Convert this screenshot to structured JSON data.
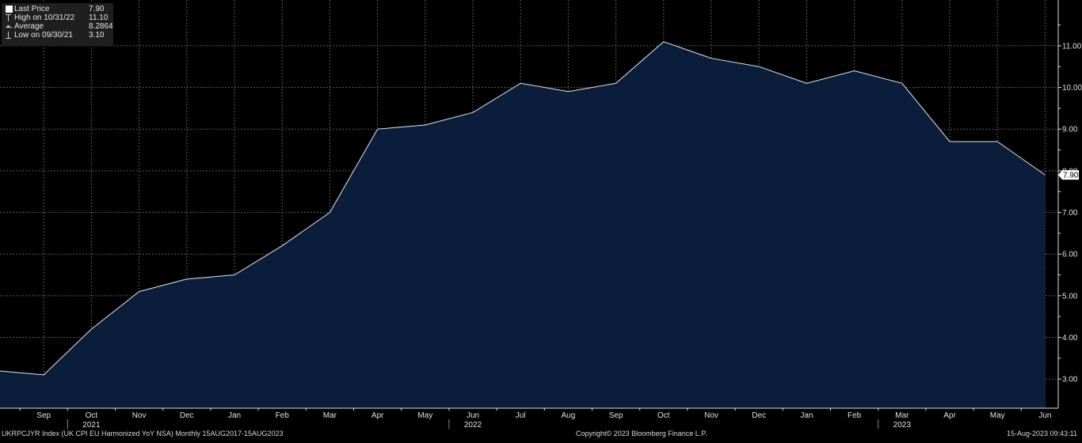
{
  "chart_data": {
    "type": "area",
    "title": "",
    "xlabel": "",
    "ylabel": "",
    "x": [
      "2021-08",
      "2021-09",
      "2021-10",
      "2021-11",
      "2021-12",
      "2022-01",
      "2022-02",
      "2022-03",
      "2022-04",
      "2022-05",
      "2022-06",
      "2022-07",
      "2022-08",
      "2022-09",
      "2022-10",
      "2022-11",
      "2022-12",
      "2023-01",
      "2023-02",
      "2023-03",
      "2023-04",
      "2023-05",
      "2023-06"
    ],
    "series": [
      {
        "values": [
          3.2,
          3.1,
          4.2,
          5.1,
          5.4,
          5.5,
          6.2,
          7.0,
          9.0,
          9.1,
          9.4,
          10.1,
          9.9,
          10.1,
          11.1,
          10.7,
          10.5,
          10.1,
          10.4,
          10.1,
          8.7,
          8.7,
          7.9
        ]
      }
    ],
    "ylim": [
      2.3,
      12.1
    ],
    "y_ticks": [
      "3.00",
      "4.00",
      "5.00",
      "6.00",
      "7.00",
      "8.00",
      "9.00",
      "10.00",
      "11.00"
    ],
    "y_tick_values": [
      3,
      4,
      5,
      6,
      7,
      8,
      9,
      10,
      11
    ],
    "x_tick_labels": [
      "Sep",
      "Oct",
      "Nov",
      "Dec",
      "Jan",
      "Feb",
      "Mar",
      "Apr",
      "May",
      "Jun",
      "Jul",
      "Aug",
      "Sep",
      "Oct",
      "Nov",
      "Dec",
      "Jan",
      "Feb",
      "Mar",
      "Apr",
      "May",
      "Jun"
    ],
    "year_labels": [
      {
        "label": "2021",
        "month_index": 2
      },
      {
        "label": "2022",
        "month_index": 10
      },
      {
        "label": "2023",
        "month_index": 19
      }
    ],
    "last_price_label": "7.90",
    "grid": true,
    "legend_position": "top-left",
    "colors": {
      "background": "#000000",
      "area_fill": "#0a1e3c",
      "line": "#e6e6e6",
      "grid": "#5a5a5a",
      "axis_text": "#e0e0e0",
      "last_price_box": "#ffffff"
    }
  },
  "legend": {
    "items": [
      {
        "label": "Last Price",
        "value": "7.90",
        "marker": "square"
      },
      {
        "label": "High on 10/31/22",
        "value": "11.10",
        "marker": "tee"
      },
      {
        "label": "Average",
        "value": "8.2864",
        "marker": "dash"
      },
      {
        "label": "Low on 09/30/21",
        "value": "3.10",
        "marker": "tee-bottom"
      }
    ]
  },
  "footer": {
    "index_label": "UKRPCJYR Index (UK CPI EU Harmonized YoY NSA)  Monthly 15AUG2017-15AUG2023",
    "copyright": "Copyright© 2023 Bloomberg Finance L.P.",
    "timestamp": "15-Aug-2023 09:43:11"
  }
}
